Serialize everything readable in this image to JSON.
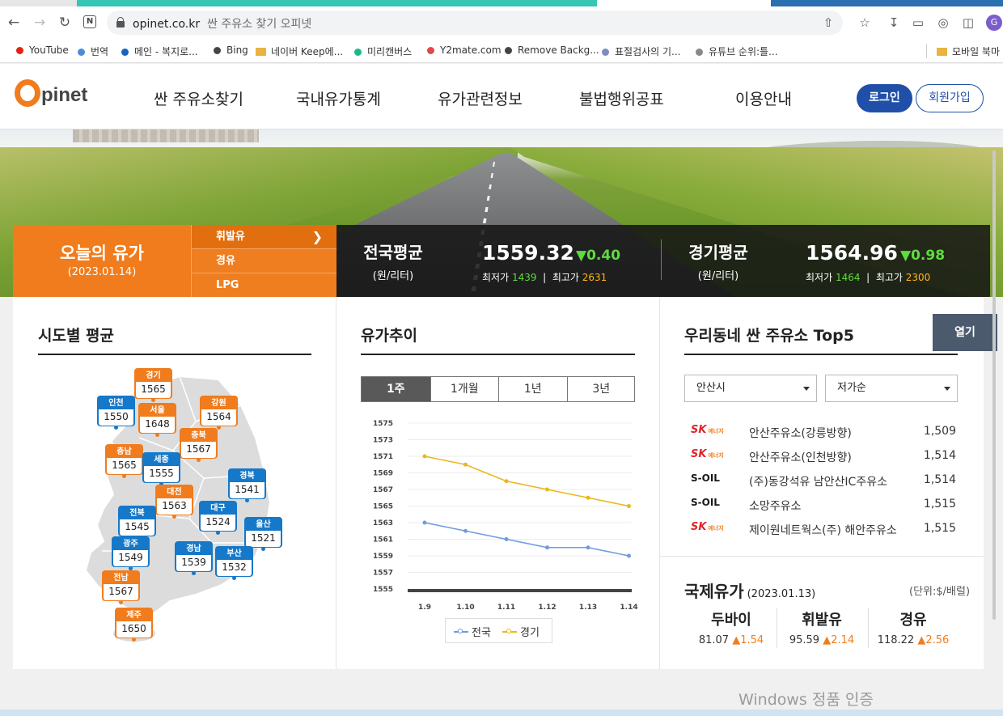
{
  "browser": {
    "url_host": "opinet.co.kr",
    "url_path": "싼 주유소 찾기 오피넷",
    "profile_initial": "G",
    "bookmarks": [
      {
        "label": "YouTube",
        "color": "#e62117"
      },
      {
        "label": "번역",
        "color": "#4a8cd8"
      },
      {
        "label": "메인 - 복지로...",
        "color": "#1762c4"
      },
      {
        "label": "Bing",
        "color": "#444444"
      },
      {
        "label": "네이버 Keep에...",
        "color": "folder"
      },
      {
        "label": "미리캔버스",
        "color": "#19b98c"
      },
      {
        "label": "Y2mate.com",
        "color": "#e2474b"
      },
      {
        "label": "Remove Backg...",
        "color": "#444444"
      },
      {
        "label": "표절검사의 기...",
        "color": "#7a8fbd"
      },
      {
        "label": "유튜브 순위:틀...",
        "color": "#888888"
      },
      {
        "label": "모바일 북마",
        "color": "folder"
      }
    ]
  },
  "site": {
    "logo_o": "O",
    "logo_rest": "pinet",
    "nav": [
      "싼 주유소찾기",
      "국내유가통계",
      "유가관련정보",
      "불법행위공표",
      "이용안내"
    ],
    "login": "로그인",
    "join": "회원가입"
  },
  "today": {
    "title": "오늘의 유가",
    "date": "(2023.01.14)",
    "fuel_tabs": [
      "휘발유",
      "경유",
      "LPG"
    ],
    "national": {
      "title": "전국평균",
      "unit": "(원/리터)",
      "value": "1559.32",
      "change": "▼0.40",
      "min_label": "최저가",
      "min": "1439",
      "max_label": "최고가",
      "max": "2631"
    },
    "gyeonggi": {
      "title": "경기평균",
      "unit": "(원/리터)",
      "value": "1564.96",
      "change": "▼0.98",
      "min_label": "최저가",
      "min": "1464",
      "max_label": "최고가",
      "max": "2300"
    }
  },
  "regions_panel": {
    "title": "시도별 평균",
    "regions": [
      {
        "name": "경기",
        "value": "1565",
        "color": "orange"
      },
      {
        "name": "인천",
        "value": "1550",
        "color": "blue"
      },
      {
        "name": "서울",
        "value": "1648",
        "color": "orange"
      },
      {
        "name": "강원",
        "value": "1564",
        "color": "orange"
      },
      {
        "name": "충북",
        "value": "1567",
        "color": "orange"
      },
      {
        "name": "충남",
        "value": "1565",
        "color": "orange"
      },
      {
        "name": "세종",
        "value": "1555",
        "color": "blue"
      },
      {
        "name": "경북",
        "value": "1541",
        "color": "blue"
      },
      {
        "name": "대전",
        "value": "1563",
        "color": "orange"
      },
      {
        "name": "전북",
        "value": "1545",
        "color": "blue"
      },
      {
        "name": "대구",
        "value": "1524",
        "color": "blue"
      },
      {
        "name": "울산",
        "value": "1521",
        "color": "blue"
      },
      {
        "name": "광주",
        "value": "1549",
        "color": "blue"
      },
      {
        "name": "경남",
        "value": "1539",
        "color": "blue"
      },
      {
        "name": "부산",
        "value": "1532",
        "color": "blue"
      },
      {
        "name": "전남",
        "value": "1567",
        "color": "orange"
      },
      {
        "name": "제주",
        "value": "1650",
        "color": "orange"
      }
    ]
  },
  "trend_panel": {
    "title": "유가추이",
    "tabs": [
      "1주",
      "1개월",
      "1년",
      "3년"
    ],
    "legend": [
      "전국",
      "경기"
    ]
  },
  "chart_data": {
    "type": "line",
    "categories": [
      "1.9",
      "1.10",
      "1.11",
      "1.12",
      "1.13",
      "1.14"
    ],
    "series": [
      {
        "name": "전국",
        "color": "#6f9be0",
        "values": [
          1563,
          1562,
          1561,
          1560,
          1560,
          1559
        ]
      },
      {
        "name": "경기",
        "color": "#e8b81c",
        "values": [
          1571,
          1570,
          1568,
          1567,
          1566,
          1565
        ]
      }
    ],
    "ylim": [
      1555,
      1575
    ],
    "yticks": [
      "1575",
      "1573",
      "1571",
      "1569",
      "1567",
      "1565",
      "1563",
      "1561",
      "1559",
      "1557",
      "1555"
    ],
    "grid": true,
    "legend_position": "bottom"
  },
  "top5_panel": {
    "title": "우리동네 싼 주유소 Top5",
    "open": "열기",
    "city_select": "안산시",
    "sort_select": "저가순",
    "stations": [
      {
        "brand": "sk",
        "brand_text": "SK",
        "brand_sub": "에너지",
        "name": "안산주유소(강릉방향)",
        "price": "1,509"
      },
      {
        "brand": "sk",
        "brand_text": "SK",
        "brand_sub": "에너지",
        "name": "안산주유소(인천방향)",
        "price": "1,514"
      },
      {
        "brand": "soil",
        "brand_text": "S-OIL",
        "brand_sub": "",
        "name": "(주)동강석유 남안산IC주유소",
        "price": "1,514"
      },
      {
        "brand": "soil",
        "brand_text": "S-OIL",
        "brand_sub": "",
        "name": "소망주유소",
        "price": "1,515"
      },
      {
        "brand": "sk",
        "brand_text": "SK",
        "brand_sub": "에너지",
        "name": "제이원네트웍스(주) 해안주유소",
        "price": "1,515"
      }
    ]
  },
  "intl": {
    "title": "국제유가",
    "date": "(2023.01.13)",
    "unit": "(단위:$/배럴)",
    "items": [
      {
        "name": "두바이",
        "value": "81.07",
        "change": "▲1.54"
      },
      {
        "name": "휘발유",
        "value": "95.59",
        "change": "▲2.14"
      },
      {
        "name": "경유",
        "value": "118.22",
        "change": "▲2.56"
      }
    ]
  },
  "watermark": "Windows 정품 인증"
}
